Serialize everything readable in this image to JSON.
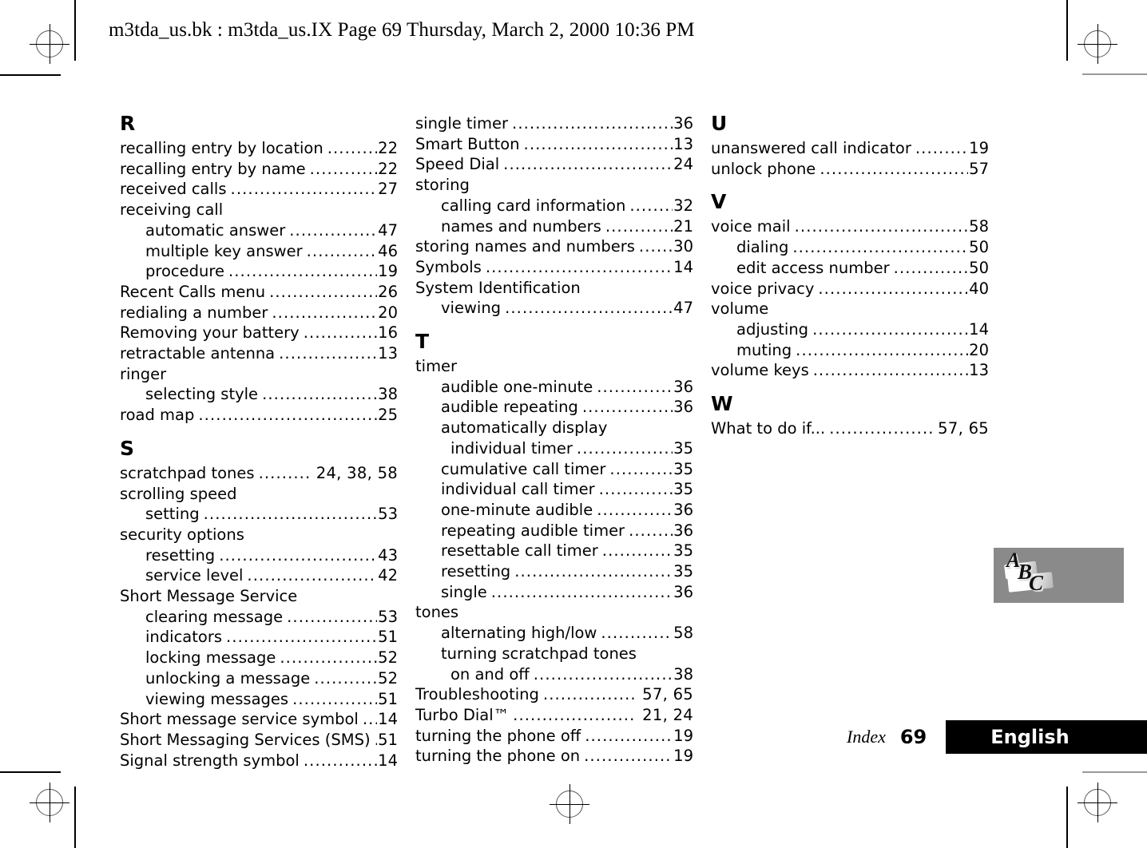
{
  "header": {
    "text": "m3tda_us.bk : m3tda_us.IX  Page 69  Thursday, March 2, 2000  10:36 PM"
  },
  "footer": {
    "index_label": "Index",
    "page_number": "69",
    "language": "English"
  },
  "logo": {
    "letter_a": "A",
    "letter_b": "B",
    "letter_c": "C"
  },
  "columns": [
    {
      "blocks": [
        {
          "type": "letter",
          "text": "R"
        },
        {
          "type": "entry",
          "level": 1,
          "label": "recalling entry by location",
          "page": "22"
        },
        {
          "type": "entry",
          "level": 1,
          "label": "recalling entry by name",
          "page": "22"
        },
        {
          "type": "entry",
          "level": 1,
          "label": "received calls",
          "page": "27"
        },
        {
          "type": "entry",
          "level": 1,
          "label": "receiving call",
          "page": ""
        },
        {
          "type": "entry",
          "level": 2,
          "label": "automatic answer",
          "page": "47"
        },
        {
          "type": "entry",
          "level": 2,
          "label": "multiple key answer",
          "page": "46"
        },
        {
          "type": "entry",
          "level": 2,
          "label": "procedure",
          "page": "19"
        },
        {
          "type": "entry",
          "level": 1,
          "label": "Recent Calls menu",
          "page": "26"
        },
        {
          "type": "entry",
          "level": 1,
          "label": "redialing a number",
          "page": "20"
        },
        {
          "type": "entry",
          "level": 1,
          "label": "Removing your battery",
          "page": "16"
        },
        {
          "type": "entry",
          "level": 1,
          "label": "retractable antenna",
          "page": "13"
        },
        {
          "type": "entry",
          "level": 1,
          "label": "ringer",
          "page": ""
        },
        {
          "type": "entry",
          "level": 2,
          "label": "selecting style",
          "page": "38"
        },
        {
          "type": "entry",
          "level": 1,
          "label": "road map",
          "page": "25"
        },
        {
          "type": "letter",
          "text": "S"
        },
        {
          "type": "entry",
          "level": 1,
          "label": "scratchpad tones",
          "page": "24, 38, 58"
        },
        {
          "type": "entry",
          "level": 1,
          "label": "scrolling speed",
          "page": ""
        },
        {
          "type": "entry",
          "level": 2,
          "label": "setting",
          "page": "53"
        },
        {
          "type": "entry",
          "level": 1,
          "label": "security options",
          "page": ""
        },
        {
          "type": "entry",
          "level": 2,
          "label": "resetting",
          "page": "43"
        },
        {
          "type": "entry",
          "level": 2,
          "label": "service level",
          "page": "42"
        },
        {
          "type": "entry",
          "level": 1,
          "label": "Short Message Service",
          "page": ""
        },
        {
          "type": "entry",
          "level": 2,
          "label": "clearing message",
          "page": "53"
        },
        {
          "type": "entry",
          "level": 2,
          "label": "indicators",
          "page": "51"
        },
        {
          "type": "entry",
          "level": 2,
          "label": "locking message",
          "page": "52"
        },
        {
          "type": "entry",
          "level": 2,
          "label": "unlocking a message",
          "page": "52"
        },
        {
          "type": "entry",
          "level": 2,
          "label": "viewing messages",
          "page": "51"
        },
        {
          "type": "entry",
          "level": 1,
          "label": "Short message service symbol",
          "page": "14"
        },
        {
          "type": "entry",
          "level": 1,
          "label": "Short Messaging Services (SMS)",
          "page": "51"
        },
        {
          "type": "entry",
          "level": 1,
          "label": "Signal strength symbol",
          "page": "14"
        }
      ]
    },
    {
      "blocks": [
        {
          "type": "entry",
          "level": 1,
          "label": "single timer",
          "page": "36"
        },
        {
          "type": "entry",
          "level": 1,
          "label": "Smart Button",
          "page": "13"
        },
        {
          "type": "entry",
          "level": 1,
          "label": "Speed Dial",
          "page": "24"
        },
        {
          "type": "entry",
          "level": 1,
          "label": "storing",
          "page": ""
        },
        {
          "type": "entry",
          "level": 2,
          "label": "calling card information",
          "page": "32"
        },
        {
          "type": "entry",
          "level": 2,
          "label": "names and numbers",
          "page": "21"
        },
        {
          "type": "entry",
          "level": 1,
          "label": "storing names and numbers",
          "page": "30"
        },
        {
          "type": "entry",
          "level": 1,
          "label": "Symbols",
          "page": "14"
        },
        {
          "type": "entry",
          "level": 1,
          "label": "System Identification",
          "page": ""
        },
        {
          "type": "entry",
          "level": 2,
          "label": "viewing",
          "page": "47"
        },
        {
          "type": "letter",
          "text": "T"
        },
        {
          "type": "entry",
          "level": 1,
          "label": "timer",
          "page": ""
        },
        {
          "type": "entry",
          "level": 2,
          "label": "audible one-minute",
          "page": "36"
        },
        {
          "type": "entry",
          "level": 2,
          "label": "audible repeating",
          "page": "36"
        },
        {
          "type": "entry",
          "level": 2,
          "label": "automatically display",
          "page": ""
        },
        {
          "type": "entry",
          "level": 3,
          "label": "individual timer",
          "page": "35"
        },
        {
          "type": "entry",
          "level": 2,
          "label": "cumulative call timer",
          "page": "35"
        },
        {
          "type": "entry",
          "level": 2,
          "label": "individual call timer",
          "page": "35"
        },
        {
          "type": "entry",
          "level": 2,
          "label": "one-minute audible",
          "page": "36"
        },
        {
          "type": "entry",
          "level": 2,
          "label": "repeating audible timer",
          "page": "36"
        },
        {
          "type": "entry",
          "level": 2,
          "label": "resettable call timer",
          "page": "35"
        },
        {
          "type": "entry",
          "level": 2,
          "label": "resetting",
          "page": "35"
        },
        {
          "type": "entry",
          "level": 2,
          "label": "single",
          "page": "36"
        },
        {
          "type": "entry",
          "level": 1,
          "label": "tones",
          "page": ""
        },
        {
          "type": "entry",
          "level": 2,
          "label": "alternating high/low",
          "page": "58"
        },
        {
          "type": "entry",
          "level": 2,
          "label": "turning scratchpad tones",
          "page": ""
        },
        {
          "type": "entry",
          "level": 3,
          "label": "on and off",
          "page": "38"
        },
        {
          "type": "entry",
          "level": 1,
          "label": "Troubleshooting",
          "page": "57, 65"
        },
        {
          "type": "entry",
          "level": 1,
          "label": "Turbo Dial™",
          "page": "21, 24"
        },
        {
          "type": "entry",
          "level": 1,
          "label": "turning the phone off",
          "page": "19"
        },
        {
          "type": "entry",
          "level": 1,
          "label": "turning the phone on",
          "page": "19"
        }
      ]
    },
    {
      "blocks": [
        {
          "type": "letter",
          "text": "U"
        },
        {
          "type": "entry",
          "level": 1,
          "label": "unanswered call indicator",
          "page": "19"
        },
        {
          "type": "entry",
          "level": 1,
          "label": "unlock phone",
          "page": "57"
        },
        {
          "type": "letter",
          "text": "V"
        },
        {
          "type": "entry",
          "level": 1,
          "label": "voice mail",
          "page": "58"
        },
        {
          "type": "entry",
          "level": 2,
          "label": "dialing",
          "page": "50"
        },
        {
          "type": "entry",
          "level": 2,
          "label": "edit access number",
          "page": "50"
        },
        {
          "type": "entry",
          "level": 1,
          "label": "voice privacy",
          "page": "40"
        },
        {
          "type": "entry",
          "level": 1,
          "label": "volume",
          "page": ""
        },
        {
          "type": "entry",
          "level": 2,
          "label": "adjusting",
          "page": "14"
        },
        {
          "type": "entry",
          "level": 2,
          "label": "muting",
          "page": "20"
        },
        {
          "type": "entry",
          "level": 1,
          "label": "volume keys",
          "page": "13"
        },
        {
          "type": "letter",
          "text": "W"
        },
        {
          "type": "entry",
          "level": 1,
          "label": "What to do if...",
          "page": "57, 65"
        }
      ]
    }
  ]
}
